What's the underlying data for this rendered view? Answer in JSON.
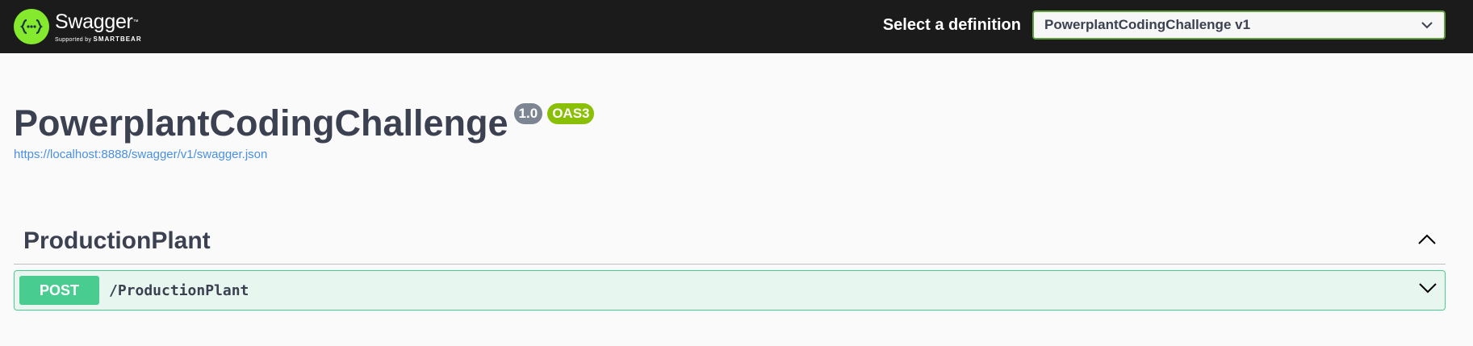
{
  "topbar": {
    "brand_name": "Swagger",
    "brand_tm": "™",
    "brand_sub_prefix": "Supported by",
    "brand_sub_company": "SMARTBEAR",
    "definition_label": "Select a definition",
    "definition_selected": "PowerplantCodingChallenge v1",
    "brand_color": "#85ea2d",
    "background_color": "#1b1b1b"
  },
  "info": {
    "title": "PowerplantCodingChallenge",
    "version": "1.0",
    "oas": "OAS3",
    "spec_url": "https://localhost:8888/swagger/v1/swagger.json"
  },
  "tags": [
    {
      "name": "ProductionPlant",
      "expanded": true,
      "operations": [
        {
          "method": "POST",
          "path": "/ProductionPlant",
          "color": "#49cc90"
        }
      ]
    }
  ],
  "icons": {
    "logo": "swagger-logo-icon",
    "definition_arrow": "chevron-down-icon",
    "tag_toggle": "chevron-up-icon",
    "operation_toggle": "chevron-down-icon"
  }
}
